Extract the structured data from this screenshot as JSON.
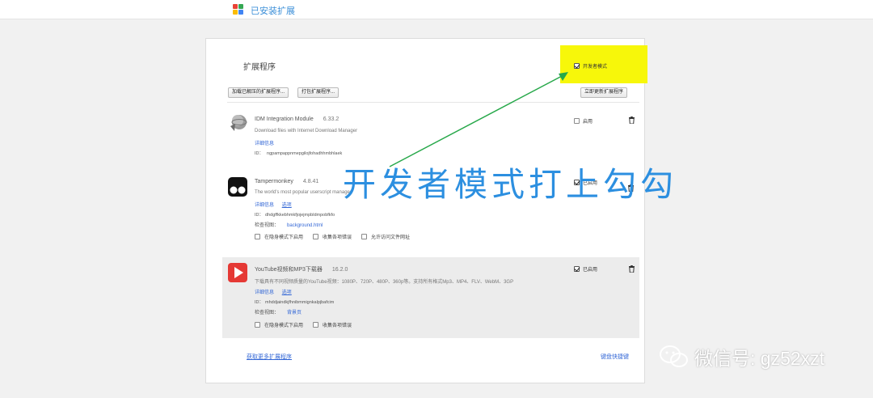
{
  "header": {
    "title": "已安装扩展",
    "logo_colors": [
      "#e94235",
      "#34a853",
      "#fbbc04",
      "#4285f4"
    ]
  },
  "panel": {
    "title": "扩展程序",
    "developer_mode": {
      "label": "开发者模式",
      "checked": true,
      "highlight_color": "#f7f70a"
    },
    "buttons": {
      "load_unpacked": "加载已解压的扩展程序...",
      "pack": "打包扩展程序...",
      "update": "立即更新扩展程序"
    }
  },
  "extensions": [
    {
      "name": "IDM Integration Module",
      "version": "6.33.2",
      "description": "Download files with Internet Download Manager",
      "links": [
        "详细信息"
      ],
      "id_label": "ID：",
      "id": "ngpampappnmepgilojfohadhhmbhlaek",
      "enabled": false,
      "enable_label": "启用",
      "icon": "idm-globe-icon"
    },
    {
      "name": "Tampermonkey",
      "version": "4.8.41",
      "description": "The world's most popular userscript manager",
      "links": [
        "详细信息",
        "选项"
      ],
      "id_label": "ID：",
      "id": "dhdgffkkebhmkfjojejmpbldmpobfkfo",
      "view_label": "检查视图：",
      "view_link": "background.html",
      "options": [
        "在隐身模式下启用",
        "收集各项错误",
        "允许访问文件网址"
      ],
      "enabled": true,
      "enable_label": "已启用",
      "icon": "tampermonkey-icon"
    },
    {
      "name": "YouTube视频和MP3下载器",
      "version": "16.2.0",
      "description": "下载具有不同视频质量的YouTube视频：1080P、720P、480P、360p等。支持所有格式Mp3、MP4、FLV、WebM、3GP",
      "links": [
        "详细信息",
        "选项"
      ],
      "id_label": "ID：",
      "id": "mhddjaindkjfhnibmmignkalpjbafcim",
      "view_label": "检查视图：",
      "view_link": "背景页",
      "options": [
        "在隐身模式下启用",
        "收集各项错误"
      ],
      "enabled": true,
      "enable_label": "已启用",
      "icon": "youtube-downloader-icon"
    }
  ],
  "footer": {
    "more_link": "获取更多扩展程序",
    "shortcuts": "键盘快捷键"
  },
  "annotation": {
    "text": "开发者模式打上勾勾",
    "color": "#2c8fe0",
    "arrow_color": "#27a84a"
  },
  "watermark": {
    "text": "微信号: gz52xzt",
    "icon": "wechat-icon"
  }
}
